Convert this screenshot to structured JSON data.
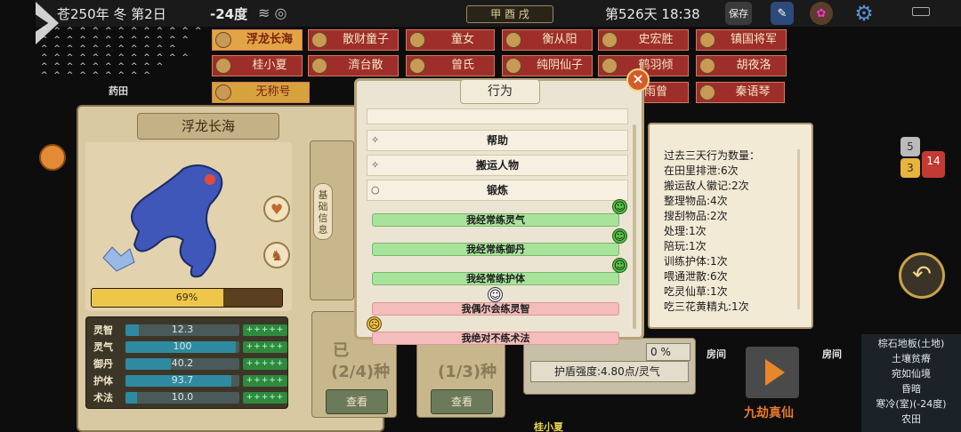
{
  "top_bar": {
    "season": "苍250年 冬 第2日",
    "temperature": "-24度",
    "ganzhi": "甲 酉 戌",
    "day_time": "第526天 18:38",
    "save_label": "保存"
  },
  "characters": [
    {
      "name": "浮龙长海",
      "style": "highlight"
    },
    {
      "name": "散财童子",
      "style": "normal"
    },
    {
      "name": "童女",
      "style": "normal"
    },
    {
      "name": "衡从阳",
      "style": "normal"
    },
    {
      "name": "史宏胜",
      "style": "normal"
    },
    {
      "name": "镇国将军",
      "style": "normal"
    },
    {
      "name": "桂小夏",
      "style": "normal"
    },
    {
      "name": "濟台散",
      "style": "normal"
    },
    {
      "name": "曾氏",
      "style": "normal"
    },
    {
      "name": "纯阴仙子",
      "style": "normal"
    },
    {
      "name": "鹤羽倾",
      "style": "normal"
    },
    {
      "name": "胡夜洛",
      "style": "normal"
    },
    {
      "name": "无称号",
      "style": "gold"
    },
    {
      "name": "雨曾",
      "style": "normal"
    },
    {
      "name": "秦语琴",
      "style": "normal"
    }
  ],
  "map_labels": {
    "field": "药田",
    "room_left": "房间",
    "room_right": "房间",
    "char_bottom": "桂小夏"
  },
  "left_panel": {
    "title": "浮龙长海",
    "hp_percent_label": "69%",
    "hp_fraction": 0.69,
    "stats": [
      {
        "name": "灵智",
        "value": "12.3",
        "fill": 0.12
      },
      {
        "name": "灵气",
        "value": "100",
        "fill": 0.97
      },
      {
        "name": "御丹",
        "value": "40.2",
        "fill": 0.4
      },
      {
        "name": "护体",
        "value": "93.7",
        "fill": 0.93
      },
      {
        "name": "术法",
        "value": "10.0",
        "fill": 0.1
      }
    ],
    "plus_label": "+++++",
    "col1_vertical": "基础信息",
    "col1_count": "(2/4)种",
    "col2_count": "(1/3)种",
    "col1_header": "已",
    "view_button": "查看",
    "view_button_2": "查看"
  },
  "modal": {
    "title": "行为",
    "close_symbol": "×",
    "menu_items": [
      {
        "icon": "✧",
        "label": "帮助"
      },
      {
        "icon": "✧",
        "label": "搬运人物"
      },
      {
        "icon": "○",
        "label": "锻炼"
      }
    ],
    "sub_items": [
      {
        "label": "我经常练灵气",
        "tone": "green",
        "emoji": "grin"
      },
      {
        "label": "我经常练御丹",
        "tone": "green",
        "emoji": "grin"
      },
      {
        "label": "我经常练护体",
        "tone": "green",
        "emoji": "grin"
      },
      {
        "label": "我偶尔会练灵智",
        "tone": "pink",
        "emoji": "neutral"
      },
      {
        "label": "我绝对不练术法",
        "tone": "pink",
        "emoji": "angry"
      }
    ]
  },
  "info_panel": {
    "lines": [
      "过去三天行为数量：",
      "在田里排泄:6次",
      "搬运敌人徽记:2次",
      "整理物品:4次",
      "搜刮物品:2次",
      "处理:1次",
      "陪玩:1次",
      "训练护体:1次",
      "喂通泄散:6次",
      "吃灵仙草:1次",
      "吃三花黄精丸:1次"
    ]
  },
  "lower_panel": {
    "pct_label": "0 %",
    "shield_label": "护盾强度:4.80点/灵气"
  },
  "right_side": {
    "badge_5": "5",
    "badge_3": "3",
    "badge_14": "14",
    "play_label": "九劫真仙",
    "undo_symbol": "↶",
    "location_lines": [
      "棕石地板(土地)",
      "土壤贫瘠",
      "宛如仙境",
      "昏暗",
      "寒冷(室)(-24度)",
      "农田"
    ]
  },
  "colors": {
    "tag_red": "#9e2e2a",
    "tag_gold": "#e2a444",
    "panel_tan": "#d9c9a2",
    "green_row": "#a8e39c",
    "pink_row": "#f4bcbc"
  }
}
